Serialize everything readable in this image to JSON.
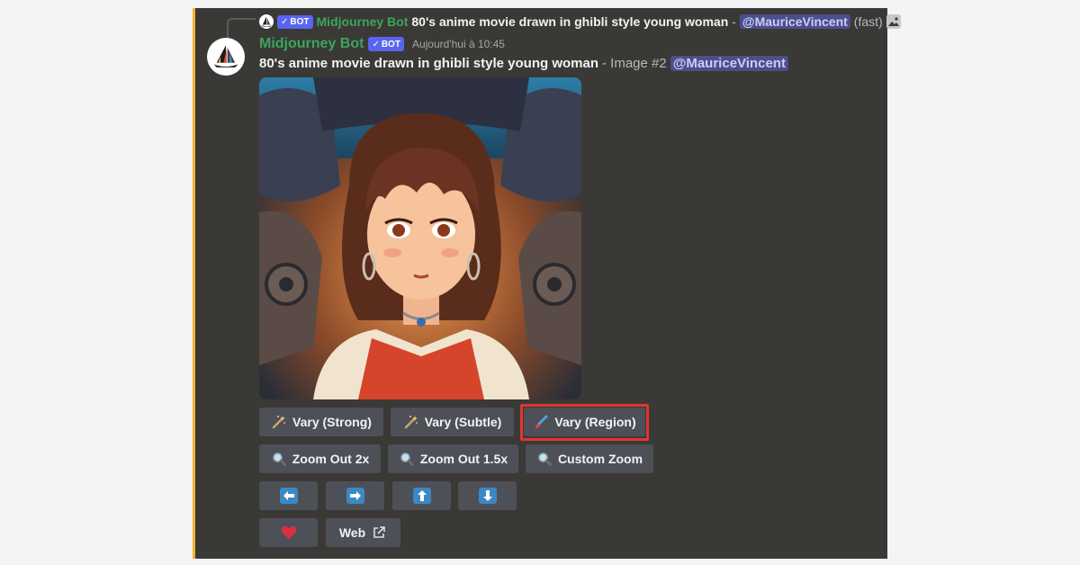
{
  "reply": {
    "bot_name": "Midjourney Bot",
    "bot_tag": "BOT",
    "prompt": "80's anime movie drawn in ghibli style young woman",
    "separator": "-",
    "mention": "@MauriceVincent",
    "speed": "(fast)",
    "image_icon": "image-icon"
  },
  "message": {
    "author": "Midjourney Bot",
    "bot_tag": "BOT",
    "timestamp": "Aujourd'hui à 10:45",
    "prompt": "80's anime movie drawn in ghibli style young woman",
    "suffix": "- Image #2",
    "mention": "@MauriceVincent"
  },
  "buttons": {
    "vary_strong": "Vary (Strong)",
    "vary_subtle": "Vary (Subtle)",
    "vary_region": "Vary (Region)",
    "zoom_out_2x": "Zoom Out 2x",
    "zoom_out_1_5x": "Zoom Out 1.5x",
    "custom_zoom": "Custom Zoom",
    "web": "Web"
  },
  "icons": {
    "vary": "magic-wand-icon",
    "region": "paintbrush-icon",
    "zoom": "magnifier-icon",
    "pan_left": "arrow-left-icon",
    "pan_right": "arrow-right-icon",
    "pan_up": "arrow-up-icon",
    "pan_down": "arrow-down-icon",
    "favorite": "heart-icon",
    "external": "external-link-icon"
  },
  "colors": {
    "panel_bg": "#3a3936",
    "accent_bar": "#f0b232",
    "bot_green": "#3ba55d",
    "bot_tag": "#5865f2",
    "button_bg": "#4e5058",
    "highlight": "#e3342f",
    "arrow_blue": "#3b88c3",
    "heart": "#dd2e44"
  }
}
